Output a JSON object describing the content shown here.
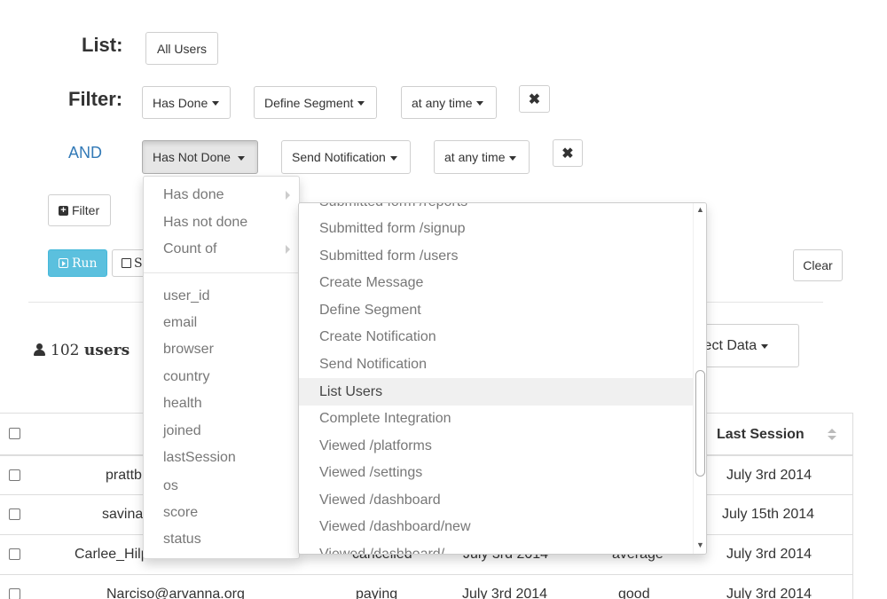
{
  "list": {
    "label": "List:",
    "value": "All Users"
  },
  "filter": {
    "label": "Filter:",
    "condition": "Has Done",
    "event": "Define Segment",
    "time": "at any time",
    "remove": "✖"
  },
  "and_row": {
    "label": "AND",
    "condition": "Has Not Done",
    "event": "Send Notification",
    "time": "at any time",
    "remove": "✖"
  },
  "toolbar": {
    "filter_label": "Filter",
    "run_label": "Run",
    "save_label": "S",
    "clear_label": "Clear",
    "select_data_label": "lect Data"
  },
  "summary": {
    "count": "102",
    "unit": "users"
  },
  "table": {
    "headers": {
      "last_session": "Last Session"
    },
    "rows": [
      {
        "email": "prattb",
        "status": "",
        "joined": "",
        "health": "",
        "last_session": "July 3rd 2014"
      },
      {
        "email": "savina",
        "status": "",
        "joined": "",
        "health": "",
        "last_session": "July 15th 2014"
      },
      {
        "email": "Carlee_Hilp",
        "status": "cancelled",
        "joined": "July 3rd 2014",
        "health": "average",
        "last_session": "July 3rd 2014"
      },
      {
        "email": "Narciso@arvanna.org",
        "status": "paying",
        "joined": "July 3rd 2014",
        "health": "good",
        "last_session": "July 3rd 2014"
      }
    ]
  },
  "condition_menu": {
    "top_items": [
      "Has done",
      "Has not done",
      "Count of"
    ],
    "property_items": [
      "user_id",
      "email",
      "browser",
      "country",
      "health",
      "joined",
      "lastSession",
      "os",
      "score",
      "status"
    ]
  },
  "event_menu": {
    "partial_top": "Submitted form /reports",
    "items": [
      "Submitted form /signup",
      "Submitted form /users",
      "Create Message",
      "Define Segment",
      "Create Notification",
      "Send Notification",
      "List Users",
      "Complete Integration",
      "Viewed /platforms",
      "Viewed /settings",
      "Viewed /dashboard",
      "Viewed /dashboard/new"
    ],
    "active_item": "List Users",
    "partial_bottom": "Viewed /dashboard/..."
  }
}
